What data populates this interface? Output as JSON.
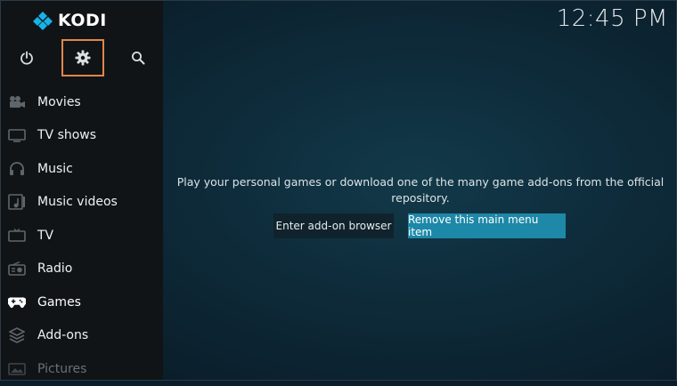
{
  "app": {
    "name": "KODI"
  },
  "clock": "12:45 PM",
  "top_buttons": [
    {
      "name": "power-icon"
    },
    {
      "name": "gear-icon",
      "selected": true
    },
    {
      "name": "search-icon"
    }
  ],
  "menu": {
    "items": [
      {
        "label": "Movies",
        "icon": "movies-icon"
      },
      {
        "label": "TV shows",
        "icon": "tv-shows-icon"
      },
      {
        "label": "Music",
        "icon": "headphones-icon"
      },
      {
        "label": "Music videos",
        "icon": "music-videos-icon"
      },
      {
        "label": "TV",
        "icon": "tv-icon"
      },
      {
        "label": "Radio",
        "icon": "radio-icon"
      },
      {
        "label": "Games",
        "icon": "gamepad-icon",
        "active": true
      },
      {
        "label": "Add-ons",
        "icon": "addons-icon"
      },
      {
        "label": "Pictures",
        "icon": "pictures-icon"
      }
    ]
  },
  "content": {
    "message": "Play your personal games or download one of the many game add-ons from the official repository.",
    "buttons": {
      "browser": "Enter add-on browser",
      "remove": "Remove this main menu item"
    }
  },
  "colors": {
    "accent": "#1d88a8",
    "selection_outline": "#e0874a",
    "logo_blue": "#17b2e7"
  }
}
